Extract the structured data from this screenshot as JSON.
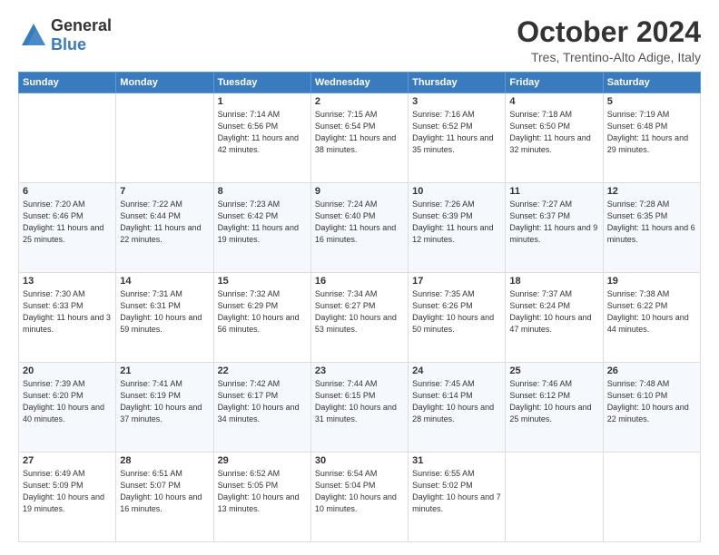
{
  "header": {
    "logo_general": "General",
    "logo_blue": "Blue",
    "month": "October 2024",
    "location": "Tres, Trentino-Alto Adige, Italy"
  },
  "days_of_week": [
    "Sunday",
    "Monday",
    "Tuesday",
    "Wednesday",
    "Thursday",
    "Friday",
    "Saturday"
  ],
  "weeks": [
    [
      {
        "day": "",
        "sunrise": "",
        "sunset": "",
        "daylight": ""
      },
      {
        "day": "",
        "sunrise": "",
        "sunset": "",
        "daylight": ""
      },
      {
        "day": "1",
        "sunrise": "Sunrise: 7:14 AM",
        "sunset": "Sunset: 6:56 PM",
        "daylight": "Daylight: 11 hours and 42 minutes."
      },
      {
        "day": "2",
        "sunrise": "Sunrise: 7:15 AM",
        "sunset": "Sunset: 6:54 PM",
        "daylight": "Daylight: 11 hours and 38 minutes."
      },
      {
        "day": "3",
        "sunrise": "Sunrise: 7:16 AM",
        "sunset": "Sunset: 6:52 PM",
        "daylight": "Daylight: 11 hours and 35 minutes."
      },
      {
        "day": "4",
        "sunrise": "Sunrise: 7:18 AM",
        "sunset": "Sunset: 6:50 PM",
        "daylight": "Daylight: 11 hours and 32 minutes."
      },
      {
        "day": "5",
        "sunrise": "Sunrise: 7:19 AM",
        "sunset": "Sunset: 6:48 PM",
        "daylight": "Daylight: 11 hours and 29 minutes."
      }
    ],
    [
      {
        "day": "6",
        "sunrise": "Sunrise: 7:20 AM",
        "sunset": "Sunset: 6:46 PM",
        "daylight": "Daylight: 11 hours and 25 minutes."
      },
      {
        "day": "7",
        "sunrise": "Sunrise: 7:22 AM",
        "sunset": "Sunset: 6:44 PM",
        "daylight": "Daylight: 11 hours and 22 minutes."
      },
      {
        "day": "8",
        "sunrise": "Sunrise: 7:23 AM",
        "sunset": "Sunset: 6:42 PM",
        "daylight": "Daylight: 11 hours and 19 minutes."
      },
      {
        "day": "9",
        "sunrise": "Sunrise: 7:24 AM",
        "sunset": "Sunset: 6:40 PM",
        "daylight": "Daylight: 11 hours and 16 minutes."
      },
      {
        "day": "10",
        "sunrise": "Sunrise: 7:26 AM",
        "sunset": "Sunset: 6:39 PM",
        "daylight": "Daylight: 11 hours and 12 minutes."
      },
      {
        "day": "11",
        "sunrise": "Sunrise: 7:27 AM",
        "sunset": "Sunset: 6:37 PM",
        "daylight": "Daylight: 11 hours and 9 minutes."
      },
      {
        "day": "12",
        "sunrise": "Sunrise: 7:28 AM",
        "sunset": "Sunset: 6:35 PM",
        "daylight": "Daylight: 11 hours and 6 minutes."
      }
    ],
    [
      {
        "day": "13",
        "sunrise": "Sunrise: 7:30 AM",
        "sunset": "Sunset: 6:33 PM",
        "daylight": "Daylight: 11 hours and 3 minutes."
      },
      {
        "day": "14",
        "sunrise": "Sunrise: 7:31 AM",
        "sunset": "Sunset: 6:31 PM",
        "daylight": "Daylight: 10 hours and 59 minutes."
      },
      {
        "day": "15",
        "sunrise": "Sunrise: 7:32 AM",
        "sunset": "Sunset: 6:29 PM",
        "daylight": "Daylight: 10 hours and 56 minutes."
      },
      {
        "day": "16",
        "sunrise": "Sunrise: 7:34 AM",
        "sunset": "Sunset: 6:27 PM",
        "daylight": "Daylight: 10 hours and 53 minutes."
      },
      {
        "day": "17",
        "sunrise": "Sunrise: 7:35 AM",
        "sunset": "Sunset: 6:26 PM",
        "daylight": "Daylight: 10 hours and 50 minutes."
      },
      {
        "day": "18",
        "sunrise": "Sunrise: 7:37 AM",
        "sunset": "Sunset: 6:24 PM",
        "daylight": "Daylight: 10 hours and 47 minutes."
      },
      {
        "day": "19",
        "sunrise": "Sunrise: 7:38 AM",
        "sunset": "Sunset: 6:22 PM",
        "daylight": "Daylight: 10 hours and 44 minutes."
      }
    ],
    [
      {
        "day": "20",
        "sunrise": "Sunrise: 7:39 AM",
        "sunset": "Sunset: 6:20 PM",
        "daylight": "Daylight: 10 hours and 40 minutes."
      },
      {
        "day": "21",
        "sunrise": "Sunrise: 7:41 AM",
        "sunset": "Sunset: 6:19 PM",
        "daylight": "Daylight: 10 hours and 37 minutes."
      },
      {
        "day": "22",
        "sunrise": "Sunrise: 7:42 AM",
        "sunset": "Sunset: 6:17 PM",
        "daylight": "Daylight: 10 hours and 34 minutes."
      },
      {
        "day": "23",
        "sunrise": "Sunrise: 7:44 AM",
        "sunset": "Sunset: 6:15 PM",
        "daylight": "Daylight: 10 hours and 31 minutes."
      },
      {
        "day": "24",
        "sunrise": "Sunrise: 7:45 AM",
        "sunset": "Sunset: 6:14 PM",
        "daylight": "Daylight: 10 hours and 28 minutes."
      },
      {
        "day": "25",
        "sunrise": "Sunrise: 7:46 AM",
        "sunset": "Sunset: 6:12 PM",
        "daylight": "Daylight: 10 hours and 25 minutes."
      },
      {
        "day": "26",
        "sunrise": "Sunrise: 7:48 AM",
        "sunset": "Sunset: 6:10 PM",
        "daylight": "Daylight: 10 hours and 22 minutes."
      }
    ],
    [
      {
        "day": "27",
        "sunrise": "Sunrise: 6:49 AM",
        "sunset": "Sunset: 5:09 PM",
        "daylight": "Daylight: 10 hours and 19 minutes."
      },
      {
        "day": "28",
        "sunrise": "Sunrise: 6:51 AM",
        "sunset": "Sunset: 5:07 PM",
        "daylight": "Daylight: 10 hours and 16 minutes."
      },
      {
        "day": "29",
        "sunrise": "Sunrise: 6:52 AM",
        "sunset": "Sunset: 5:05 PM",
        "daylight": "Daylight: 10 hours and 13 minutes."
      },
      {
        "day": "30",
        "sunrise": "Sunrise: 6:54 AM",
        "sunset": "Sunset: 5:04 PM",
        "daylight": "Daylight: 10 hours and 10 minutes."
      },
      {
        "day": "31",
        "sunrise": "Sunrise: 6:55 AM",
        "sunset": "Sunset: 5:02 PM",
        "daylight": "Daylight: 10 hours and 7 minutes."
      },
      {
        "day": "",
        "sunrise": "",
        "sunset": "",
        "daylight": ""
      },
      {
        "day": "",
        "sunrise": "",
        "sunset": "",
        "daylight": ""
      }
    ]
  ]
}
